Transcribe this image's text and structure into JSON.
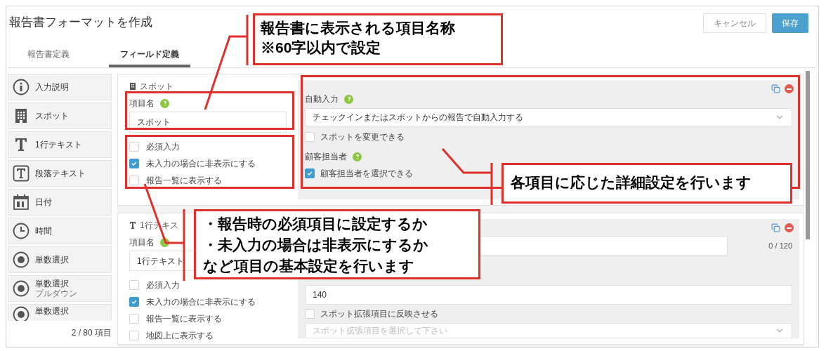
{
  "header": {
    "title": "報告書フォーマットを作成",
    "buttons": [
      {
        "label": "キャンセル",
        "kind": "secondary"
      },
      {
        "label": "保存",
        "kind": "primary"
      }
    ]
  },
  "tabs": [
    {
      "label": "報告書定義",
      "selected": false
    },
    {
      "label": "フィールド定義",
      "selected": true
    }
  ],
  "palette": {
    "items": [
      {
        "label": "入力説明",
        "kind": "info"
      },
      {
        "label": "スポット",
        "kind": "building"
      },
      {
        "label": "1行テキスト",
        "kind": "text"
      },
      {
        "label": "段落テキスト",
        "kind": "paragraph"
      },
      {
        "label": "日付",
        "kind": "date"
      },
      {
        "label": "時間",
        "kind": "time"
      },
      {
        "label": "単数選択",
        "kind": "radio"
      },
      {
        "label": "単数選択",
        "sublabel": "プルダウン",
        "kind": "radio"
      },
      {
        "label": "単数選択",
        "kind": "radio"
      }
    ],
    "count": "2 / 80 項目"
  },
  "cards": [
    {
      "type_label": "スポット",
      "kind": "building",
      "name_label": "項目名",
      "name_value": "スポット",
      "options": [
        {
          "label": "必須入力",
          "checked": false
        },
        {
          "label": "未入力の場合に非表示にする",
          "checked": true
        },
        {
          "label": "報告一覧に表示する",
          "checked": false
        }
      ],
      "details": [
        {
          "kind": "label",
          "text": "自動入力"
        },
        {
          "kind": "select",
          "value": "チェックインまたはスポットからの報告で自動入力する"
        },
        {
          "kind": "checkbox",
          "label": "スポットを変更できる",
          "checked": false
        },
        {
          "kind": "label",
          "text": "顧客担当者"
        },
        {
          "kind": "checkbox",
          "label": "顧客担当者を選択できる",
          "checked": true
        }
      ]
    },
    {
      "type_label": "1行テキス",
      "kind": "text",
      "name_label": "項目名",
      "name_value": "1行テキスト",
      "options": [
        {
          "label": "必須入力",
          "checked": false
        },
        {
          "label": "未入力の場合に非表示にする",
          "checked": true
        },
        {
          "label": "報告一覧に表示する",
          "checked": false
        },
        {
          "label": "地図上に表示する",
          "checked": false
        }
      ],
      "details": [
        {
          "kind": "input",
          "counter": "0 / 120"
        },
        {
          "kind": "input",
          "value": "140"
        },
        {
          "kind": "checkbox",
          "label": "スポット拡張項目に反映させる",
          "checked": false
        },
        {
          "kind": "select",
          "placeholder": "スポット拡張項目を選択して下さい"
        }
      ]
    }
  ],
  "callouts": [
    {
      "lines": [
        "報告書に表示される項目名称",
        "※60字以内で設定"
      ]
    },
    {
      "lines": [
        "各項目に応じた詳細設定を行います"
      ]
    },
    {
      "lines": [
        "・報告時の必須項目に設定するか",
        "・未入力の場合は非表示にするか",
        "など項目の基本設定を行います"
      ]
    }
  ]
}
